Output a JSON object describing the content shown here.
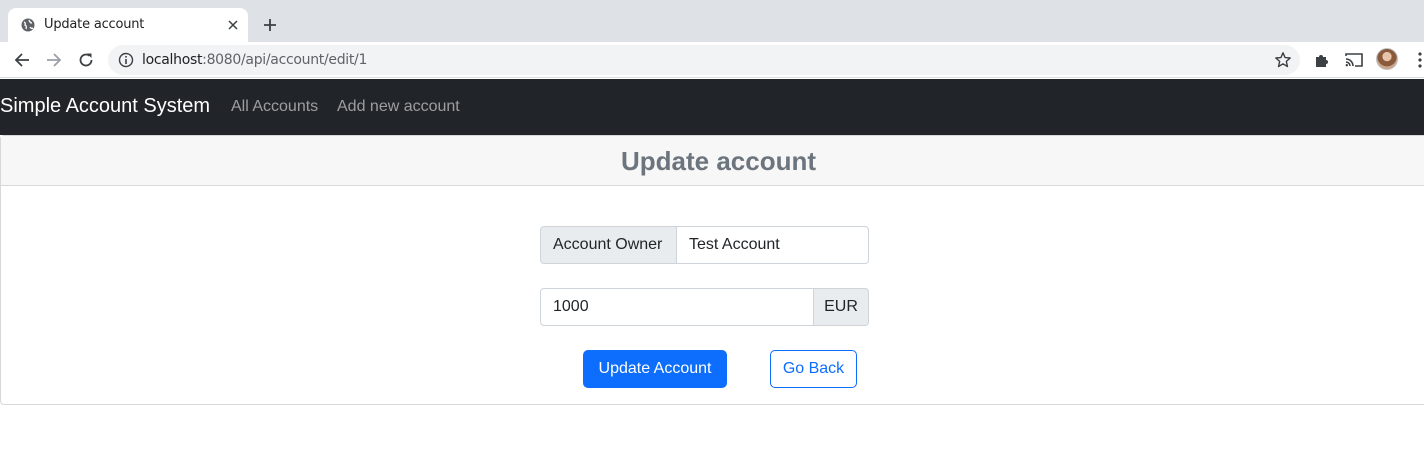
{
  "browser": {
    "tab_title": "Update account",
    "tab_favicon": "globe-icon",
    "url_host": "localhost",
    "url_path": ":8080/api/account/edit/1",
    "icons": [
      "back-icon",
      "forward-icon",
      "reload-icon",
      "info-icon",
      "star-icon",
      "puzzle-icon",
      "cast-icon",
      "profile-avatar",
      "menu-icon"
    ]
  },
  "navbar": {
    "brand": "Simple Account System",
    "links": [
      "All Accounts",
      "Add new account"
    ]
  },
  "card": {
    "title": "Update account"
  },
  "form": {
    "owner_label": "Account Owner",
    "owner_value": "Test Account",
    "amount_value": "1000",
    "currency_label": "EUR"
  },
  "buttons": {
    "update": "Update Account",
    "back": "Go Back"
  },
  "colors": {
    "navbar_bg": "#212529",
    "primary": "#0d6efd",
    "title_gray": "#6c757d"
  }
}
